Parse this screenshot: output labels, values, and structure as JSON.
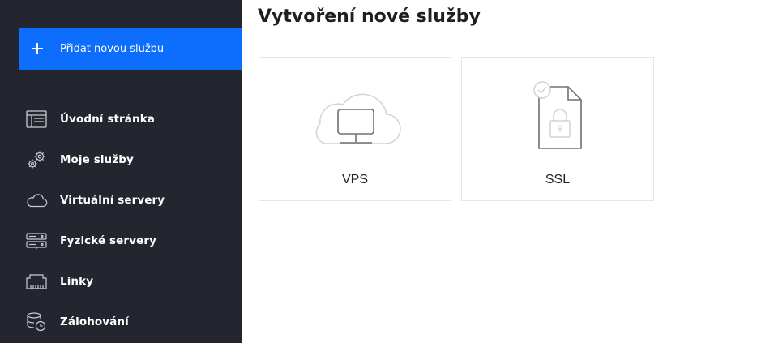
{
  "sidebar": {
    "add_button": {
      "label": "Přidat novou službu",
      "icon": "plus-icon"
    },
    "items": [
      {
        "label": "Úvodní stránka",
        "icon": "browser-window-icon"
      },
      {
        "label": "Moje služby",
        "icon": "gears-icon"
      },
      {
        "label": "Virtuální servery",
        "icon": "cloud-icon"
      },
      {
        "label": "Fyzické servery",
        "icon": "server-rack-icon"
      },
      {
        "label": "Linky",
        "icon": "network-port-icon"
      },
      {
        "label": "Zálohování",
        "icon": "database-clock-icon"
      }
    ]
  },
  "main": {
    "title": "Vytvoření nové služby",
    "cards": [
      {
        "label": "VPS",
        "icon": "cloud-monitor-icon"
      },
      {
        "label": "SSL",
        "icon": "certificate-lock-icon"
      }
    ]
  },
  "colors": {
    "sidebar_bg": "#23262e",
    "accent": "#0d6efd",
    "text_dark": "#1d1f24"
  }
}
